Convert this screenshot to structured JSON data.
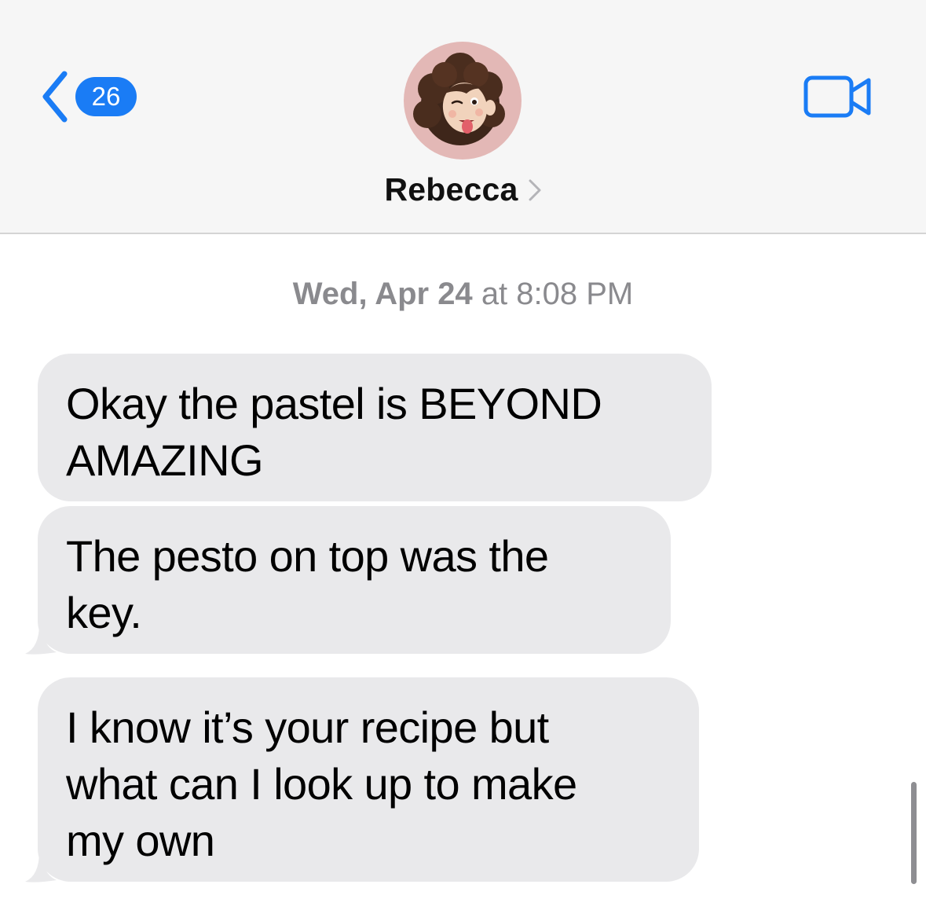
{
  "header": {
    "unread_count": "26",
    "contact_name": "Rebecca",
    "colors": {
      "accent": "#1a7cf5",
      "header_bg": "#f6f6f6",
      "avatar_bg": "#e3b8b6"
    },
    "icons": {
      "back": "chevron-left-icon",
      "video": "video-camera-icon",
      "name_chevron": "chevron-right-icon"
    }
  },
  "conversation": {
    "timestamp_day": "Wed, Apr 24",
    "timestamp_time": "at 8:08 PM",
    "messages": [
      {
        "text_lines": [
          "Okay the pastel is BEYOND",
          "AMAZING"
        ]
      },
      {
        "text_lines": [
          "The pesto on top was the",
          "key."
        ]
      },
      {
        "text_lines": [
          "I know it’s your recipe but",
          "what can I look up to make",
          "my own"
        ]
      }
    ],
    "colors": {
      "incoming_bubble": "#e9e9eb",
      "timestamp_text": "#8a8a8e"
    }
  }
}
